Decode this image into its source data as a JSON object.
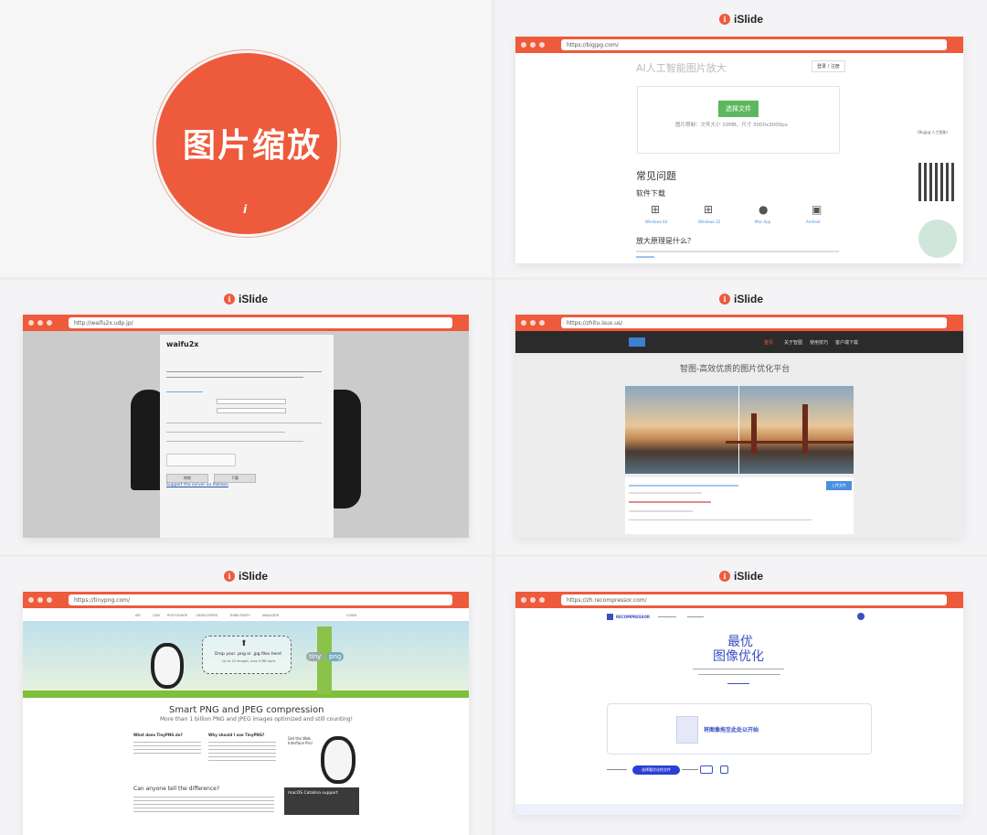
{
  "cover": {
    "title": "图片缩放",
    "glyph": "i"
  },
  "logo_text": "iSlide",
  "colors": {
    "accent": "#ee5a3c",
    "bg": "#f4f4f6"
  },
  "panel1": {
    "url": "https://bigjpg.com/",
    "heading": "AI人工智能图片放大",
    "login": "登录 / 注册",
    "upload_button": "选择文件",
    "limits": "图片限制：文件大小 10MB，尺寸 3000x3000px",
    "faq": "常见问题",
    "download": "软件下载",
    "os_labels": [
      "Windows 64",
      "Windows 32",
      "Mac App",
      "Android"
    ],
    "principle": "放大原理是什么？",
    "qr_caption": "(Bigjpg 人工智能)"
  },
  "panel2": {
    "url": "http://waifu2x.udp.jp/",
    "title": "waifu2x",
    "btn1": "转换",
    "btn2": "下载",
    "link": "Support the server on Patreon"
  },
  "panel3": {
    "url": "https://zhitu.isux.us/",
    "nav": [
      "首页",
      "关于智图",
      "使用技巧",
      "客户端下载"
    ],
    "headline": "智图-高效优质的图片优化平台",
    "button": "上传文件"
  },
  "panel4": {
    "url": "https://tinypng.com/",
    "nav": [
      "API",
      "CDN",
      "PHOTOSHOP",
      "DEVELOPERS",
      "THIRD PARTY",
      "ANALYZER",
      "LOGIN"
    ],
    "drop": "Drop your .png or .jpg files here!",
    "drop_sub": "Up to 20 images, max 5 MB each.",
    "tiny": "tiny",
    "png": "png",
    "headline": "Smart PNG and JPEG compression",
    "subline": "More than 1 billion PNG and JPEG images optimized and still counting!",
    "q1": "What does TinyPNG do?",
    "q2": "Why should I use TinyPNG?",
    "q3": "Get the Web Interface Pro!",
    "q4": "Can anyone tell the difference?",
    "mac": "macOS Catalina support"
  },
  "panel5": {
    "url": "https://zh.recompressor.com/",
    "brand": "RECOMPRESSOR",
    "headline1": "最优",
    "headline2": "图像优化",
    "drop": "将图像拖至此处以开始",
    "button": "选择要优化的文件"
  }
}
